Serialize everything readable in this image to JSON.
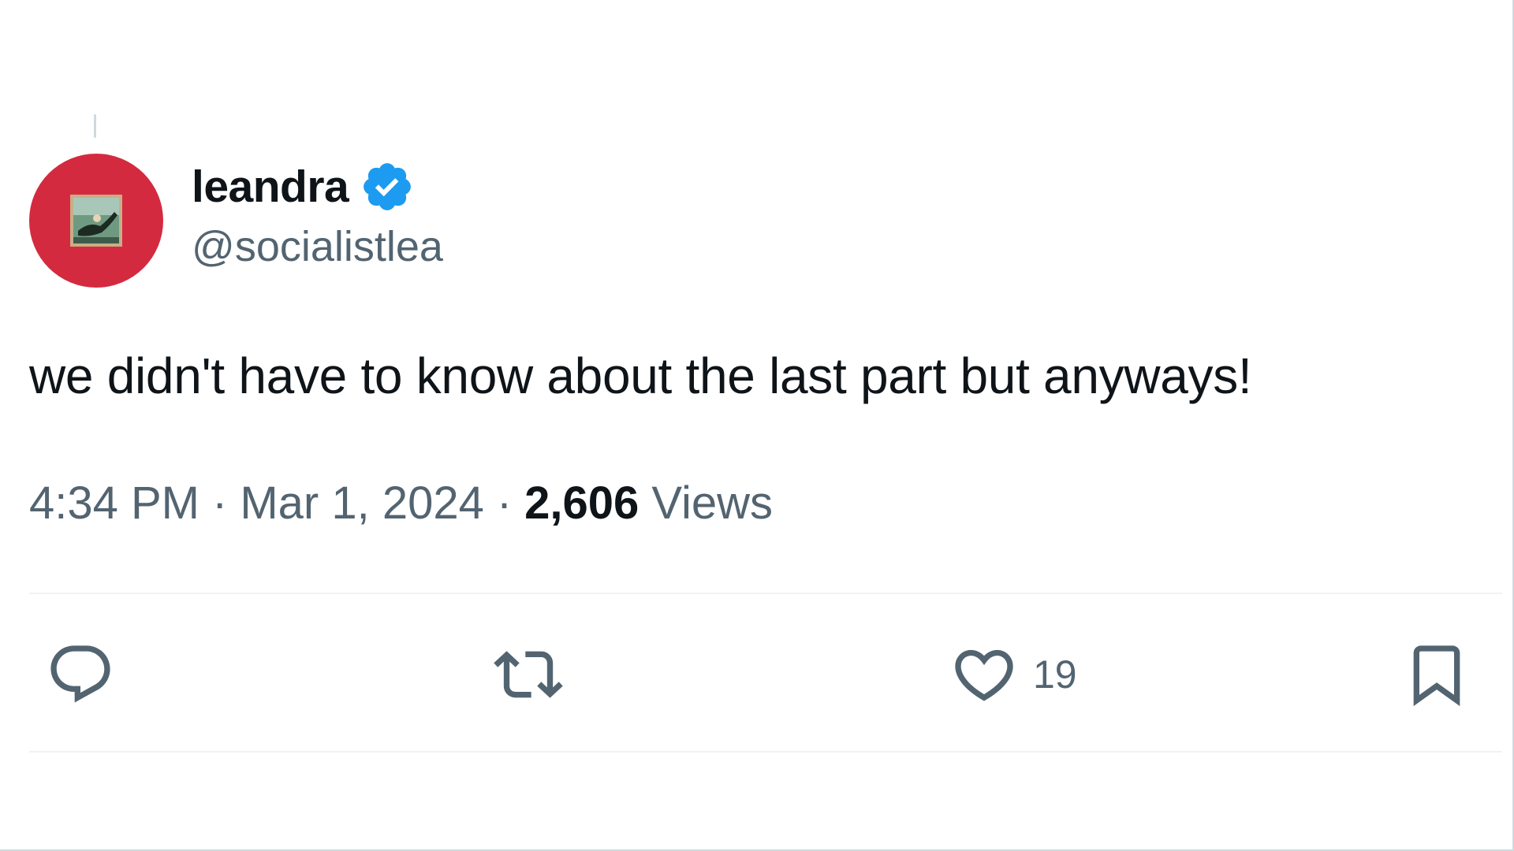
{
  "tweet": {
    "author": {
      "display_name": "leandra",
      "handle": "@socialistlea",
      "verified": true,
      "avatar_color": "#d42a3f"
    },
    "text": "we didn't have to know about the last part but anyways!",
    "time": "4:34 PM",
    "separator": "·",
    "date": "Mar 1, 2024",
    "views_count": "2,606",
    "views_label": "Views"
  },
  "actions": {
    "reply": {
      "icon": "reply-icon"
    },
    "repost": {
      "icon": "repost-icon"
    },
    "like": {
      "icon": "heart-icon",
      "count": "19"
    },
    "bookmark": {
      "icon": "bookmark-icon"
    }
  },
  "colors": {
    "text_primary": "#0f1419",
    "text_secondary": "#536471",
    "verified_blue": "#1d9bf0",
    "divider": "#eff3f4"
  }
}
